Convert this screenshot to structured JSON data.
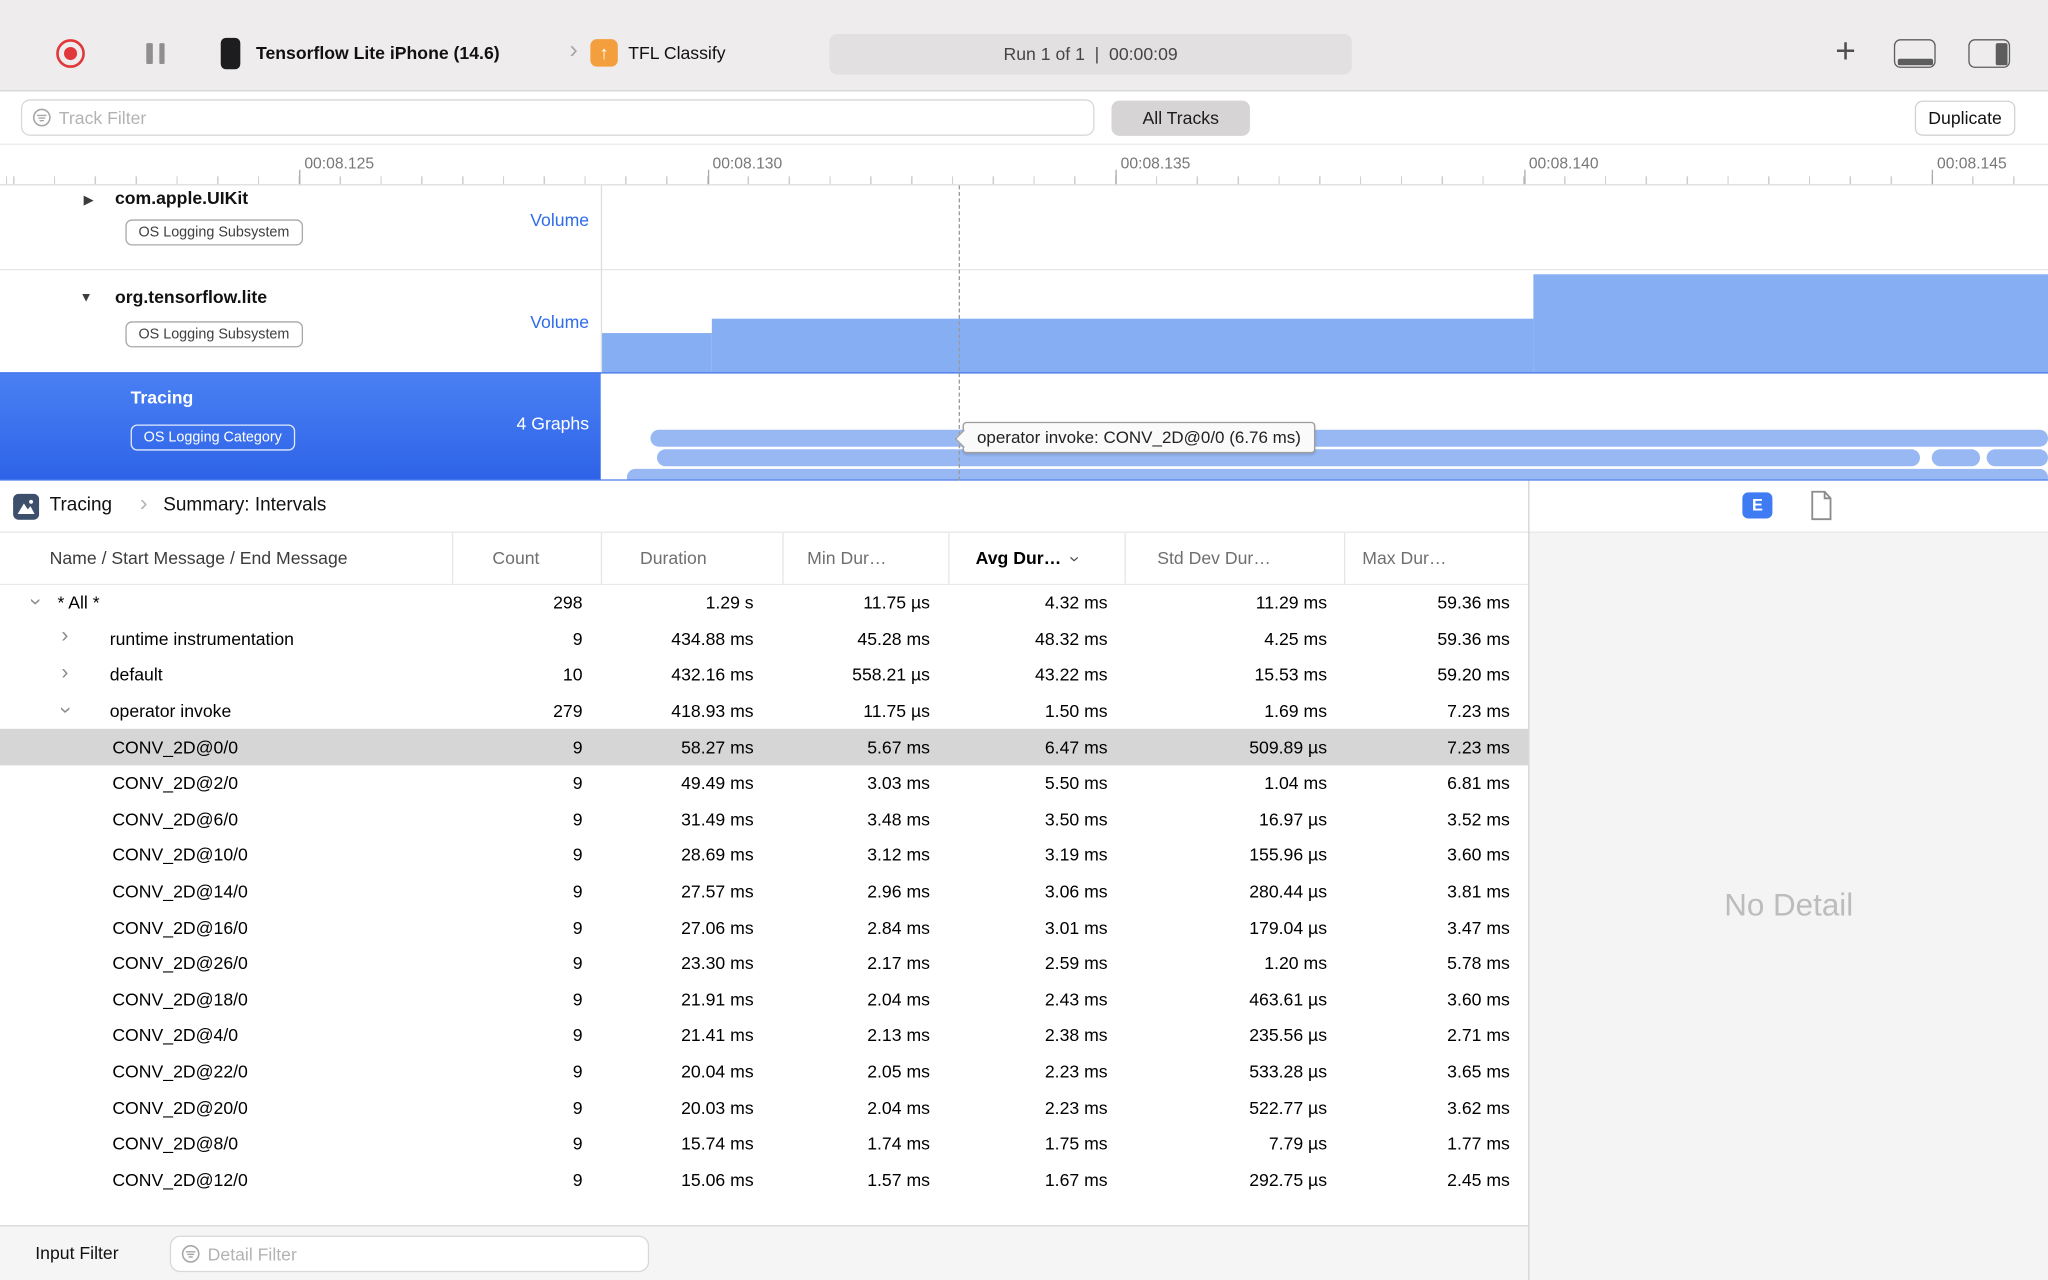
{
  "toolbar": {
    "device_name": "Tensorflow Lite iPhone (14.6)",
    "process_name": "TFL Classify",
    "run_status": "Run 1 of 1  |  00:00:09"
  },
  "filter_bar": {
    "track_filter_placeholder": "Track Filter",
    "all_tracks_label": "All Tracks",
    "duplicate_label": "Duplicate"
  },
  "ruler": {
    "tick_labels": [
      "00:08.125",
      "00:08.130",
      "00:08.135",
      "00:08.140",
      "00:08.145"
    ]
  },
  "tracks": [
    {
      "name": "com.apple.UIKit",
      "badge": "OS Logging Subsystem",
      "meta": "Volume"
    },
    {
      "name": "org.tensorflow.lite",
      "badge": "OS Logging Subsystem",
      "meta": "Volume"
    },
    {
      "name": "Tracing",
      "badge": "OS Logging Category",
      "meta": "4 Graphs"
    }
  ],
  "timeline": {
    "tooltip": "operator invoke: CONV_2D@0/0 (6.76 ms)"
  },
  "breadcrumb": {
    "instrument": "Tracing",
    "page": "Summary: Intervals"
  },
  "detail_panel": {
    "e_badge": "E",
    "no_detail": "No Detail"
  },
  "bottom_bar": {
    "input_filter_label": "Input Filter",
    "detail_filter_placeholder": "Detail Filter"
  },
  "colors": {
    "accent_blue": "#3a72ee",
    "chart_blue": "#86aef3",
    "capsule_blue": "#98b8f3",
    "selected_row_gray": "#d7d6d6",
    "record_red": "#e0383b"
  },
  "table": {
    "columns": [
      "Name / Start Message / End Message",
      "Count",
      "Duration",
      "Min Dur…",
      "Avg Dur…",
      "Std Dev Dur…",
      "Max Dur…"
    ],
    "rows": [
      {
        "name": "* All *",
        "level": 0,
        "disclosure": "expanded",
        "count": "298",
        "duration": "1.29 s",
        "min": "11.75 µs",
        "avg": "4.32 ms",
        "std": "11.29 ms",
        "max": "59.36 ms"
      },
      {
        "name": "runtime instrumentation",
        "level": 1,
        "disclosure": "collapsed",
        "count": "9",
        "duration": "434.88 ms",
        "min": "45.28 ms",
        "avg": "48.32 ms",
        "std": "4.25 ms",
        "max": "59.36 ms"
      },
      {
        "name": "default",
        "level": 1,
        "disclosure": "collapsed",
        "count": "10",
        "duration": "432.16 ms",
        "min": "558.21 µs",
        "avg": "43.22 ms",
        "std": "15.53 ms",
        "max": "59.20 ms"
      },
      {
        "name": "operator invoke",
        "level": 1,
        "disclosure": "expanded",
        "count": "279",
        "duration": "418.93 ms",
        "min": "11.75 µs",
        "avg": "1.50 ms",
        "std": "1.69 ms",
        "max": "7.23 ms"
      },
      {
        "name": "CONV_2D@0/0",
        "level": 2,
        "selected": true,
        "count": "9",
        "duration": "58.27 ms",
        "min": "5.67 ms",
        "avg": "6.47 ms",
        "std": "509.89 µs",
        "max": "7.23 ms"
      },
      {
        "name": "CONV_2D@2/0",
        "level": 2,
        "count": "9",
        "duration": "49.49 ms",
        "min": "3.03 ms",
        "avg": "5.50 ms",
        "std": "1.04 ms",
        "max": "6.81 ms"
      },
      {
        "name": "CONV_2D@6/0",
        "level": 2,
        "count": "9",
        "duration": "31.49 ms",
        "min": "3.48 ms",
        "avg": "3.50 ms",
        "std": "16.97 µs",
        "max": "3.52 ms"
      },
      {
        "name": "CONV_2D@10/0",
        "level": 2,
        "count": "9",
        "duration": "28.69 ms",
        "min": "3.12 ms",
        "avg": "3.19 ms",
        "std": "155.96 µs",
        "max": "3.60 ms"
      },
      {
        "name": "CONV_2D@14/0",
        "level": 2,
        "count": "9",
        "duration": "27.57 ms",
        "min": "2.96 ms",
        "avg": "3.06 ms",
        "std": "280.44 µs",
        "max": "3.81 ms"
      },
      {
        "name": "CONV_2D@16/0",
        "level": 2,
        "count": "9",
        "duration": "27.06 ms",
        "min": "2.84 ms",
        "avg": "3.01 ms",
        "std": "179.04 µs",
        "max": "3.47 ms"
      },
      {
        "name": "CONV_2D@26/0",
        "level": 2,
        "count": "9",
        "duration": "23.30 ms",
        "min": "2.17 ms",
        "avg": "2.59 ms",
        "std": "1.20 ms",
        "max": "5.78 ms"
      },
      {
        "name": "CONV_2D@18/0",
        "level": 2,
        "count": "9",
        "duration": "21.91 ms",
        "min": "2.04 ms",
        "avg": "2.43 ms",
        "std": "463.61 µs",
        "max": "3.60 ms"
      },
      {
        "name": "CONV_2D@4/0",
        "level": 2,
        "count": "9",
        "duration": "21.41 ms",
        "min": "2.13 ms",
        "avg": "2.38 ms",
        "std": "235.56 µs",
        "max": "2.71 ms"
      },
      {
        "name": "CONV_2D@22/0",
        "level": 2,
        "count": "9",
        "duration": "20.04 ms",
        "min": "2.05 ms",
        "avg": "2.23 ms",
        "std": "533.28 µs",
        "max": "3.65 ms"
      },
      {
        "name": "CONV_2D@20/0",
        "level": 2,
        "count": "9",
        "duration": "20.03 ms",
        "min": "2.04 ms",
        "avg": "2.23 ms",
        "std": "522.77 µs",
        "max": "3.62 ms"
      },
      {
        "name": "CONV_2D@8/0",
        "level": 2,
        "count": "9",
        "duration": "15.74 ms",
        "min": "1.74 ms",
        "avg": "1.75 ms",
        "std": "7.79 µs",
        "max": "1.77 ms"
      },
      {
        "name": "CONV_2D@12/0",
        "level": 2,
        "count": "9",
        "duration": "15.06 ms",
        "min": "1.57 ms",
        "avg": "1.67 ms",
        "std": "292.75 µs",
        "max": "2.45 ms"
      }
    ]
  }
}
